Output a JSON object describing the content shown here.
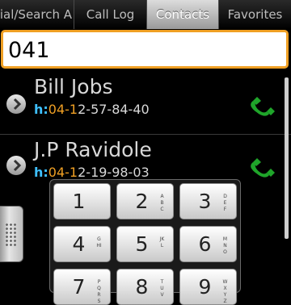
{
  "tabs": [
    {
      "label": "Dial/Search A"
    },
    {
      "label": "Call Log"
    },
    {
      "label": "Contacts"
    },
    {
      "label": "Favorites"
    }
  ],
  "active_tab": "Contacts",
  "search": {
    "value": "041"
  },
  "contacts": [
    {
      "name": "Bill Jobs",
      "prefix": "h:",
      "match": "04-1",
      "rest": "2-57-84-40"
    },
    {
      "name": "J.P Ravidole",
      "prefix": "h:",
      "match": "04-1",
      "rest": "2-19-98-03"
    }
  ],
  "keypad": [
    {
      "digit": "1",
      "letters": ""
    },
    {
      "digit": "2",
      "letters": "ABC"
    },
    {
      "digit": "3",
      "letters": "DEF"
    },
    {
      "digit": "4",
      "letters": "GHI"
    },
    {
      "digit": "5",
      "letters": "JKL"
    },
    {
      "digit": "6",
      "letters": "MNO"
    },
    {
      "digit": "7",
      "letters": "PQRS"
    },
    {
      "digit": "8",
      "letters": "TUV"
    },
    {
      "digit": "9",
      "letters": "WXYZ"
    }
  ],
  "icons": {
    "row_chevron": "chevron-right-icon",
    "call": "phone-icon",
    "keypad_handle": "dialpad-handle-icon"
  },
  "colors": {
    "accent": "#f0a024",
    "label_prefix": "#3ec0ff",
    "call_icon": "#1fa52a"
  }
}
